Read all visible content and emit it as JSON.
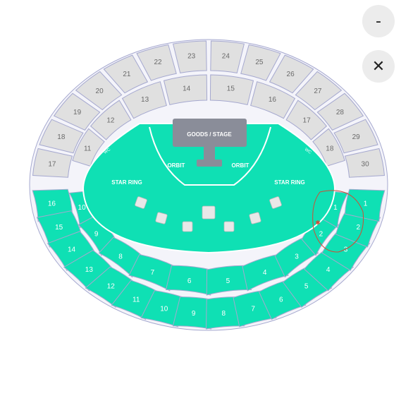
{
  "controls": {
    "zoom_out_label": "-",
    "close_label": "✕"
  },
  "stage": {
    "label": "GOODS / STAGE"
  },
  "floor": {
    "orbit_left": "ORBIT",
    "orbit_right": "ORBIT",
    "star_ring_left": "STAR RING",
    "star_ring_right": "STAR RING",
    "wc_left": "WC",
    "wc_right": "WC"
  },
  "outer_ring_grey": [
    "17",
    "18",
    "19",
    "20",
    "21",
    "22",
    "23",
    "24",
    "25",
    "26",
    "27",
    "28",
    "29",
    "30"
  ],
  "outer_ring_green": [
    "16",
    "15",
    "14",
    "13",
    "12",
    "11",
    "10",
    "9",
    "8",
    "7",
    "6",
    "5",
    "4",
    "3",
    "2",
    "1"
  ],
  "inner_ring_grey": [
    "11",
    "12",
    "13",
    "14",
    "15",
    "16",
    "17",
    "18"
  ],
  "inner_ring_green": [
    "10",
    "9",
    "8",
    "7",
    "6",
    "5",
    "4",
    "3",
    "2",
    "1"
  ],
  "colors": {
    "available": "#0fe0b4",
    "unavailable": "#e0e0e0",
    "stage": "#8a8d99",
    "outline": "#a5a8cf",
    "annotation": "#d34a32"
  }
}
